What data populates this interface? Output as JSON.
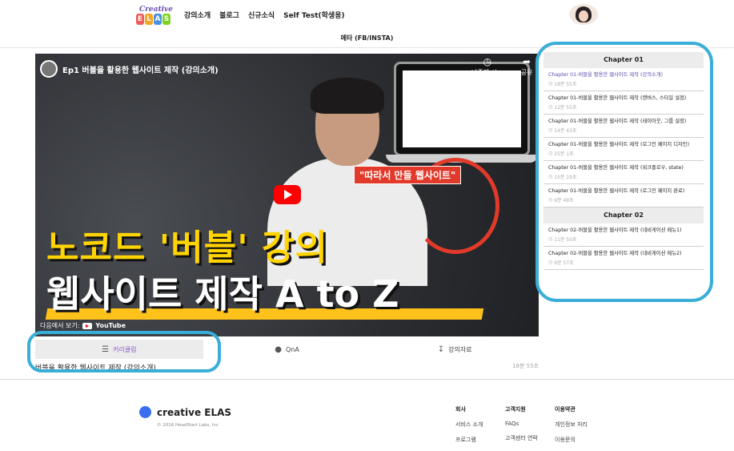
{
  "header": {
    "logo_top": "Creative",
    "logo_letters": [
      "E",
      "L",
      "A",
      "S"
    ],
    "logo_colors": [
      "#f05a5a",
      "#f5a623",
      "#4a90e2",
      "#7ed321"
    ],
    "nav": [
      "강의소개",
      "블로그",
      "신규소식",
      "Self Test(학생용)"
    ],
    "subnav": "메타 (FB/INSTA)"
  },
  "video": {
    "title": "Ep1 버블을 활용한 웹사이트 제작 (강의소개)",
    "watch_later": "나중에 시...",
    "share": "공유",
    "ribbon": "\"따라서 만들 웹사이트\"",
    "headline1": "노코드 '버블' 강의",
    "headline2": "웹사이트 제작 A to Z",
    "watch_on": "다음에서 보기:",
    "youtube": "YouTube"
  },
  "tabs": [
    {
      "label": "커리큘럼",
      "icon": "layers-icon"
    },
    {
      "label": "QnA",
      "icon": "chat-icon"
    },
    {
      "label": "강의자료",
      "icon": "download-icon"
    }
  ],
  "current_lecture": {
    "title": "버블을 활용한 웹사이트 제작 (강의소개)",
    "duration": "18분 55초"
  },
  "curriculum": {
    "chapters": [
      {
        "name": "Chapter 01",
        "lessons": [
          {
            "title": "Chapter 01-버블을 활용한 웹사이트 제작 (강의소개)",
            "duration": "18분 55초"
          },
          {
            "title": "Chapter 01-버블을 활용한 웹사이트 제작 (캔버스, 스타일 설정)",
            "duration": "12분 55초"
          },
          {
            "title": "Chapter 01-버블을 활용한 웹사이트 제작 (레이아웃, 그룹 설정)",
            "duration": "14분 43초"
          },
          {
            "title": "Chapter 01-버블을 활용한 웹사이트 제작 (로그인 페이지 디자인)",
            "duration": "25분 1초"
          },
          {
            "title": "Chapter 01-버블을 활용한 웹사이트 제작 (워크플로우, state)",
            "duration": "15분 19초"
          },
          {
            "title": "Chapter 01-버블을 활용한 웹사이트 제작 (로그인 페이지 완료)",
            "duration": "9분 49초"
          }
        ]
      },
      {
        "name": "Chapter 02",
        "lessons": [
          {
            "title": "Chapter 02-버블을 활용한 웹사이트 제작 (네비게이션 메뉴1)",
            "duration": "11분 50초"
          },
          {
            "title": "Chapter 02-버블을 활용한 웹사이트 제작 (네비게이션 메뉴2)",
            "duration": "9분 57초"
          }
        ]
      }
    ]
  },
  "footer": {
    "brand": "creative ELAS",
    "copyright": "© 2016 HeadStart Labs, Inc",
    "columns": [
      {
        "heading": "회사",
        "items": [
          "서비스 소개",
          "프로그램"
        ]
      },
      {
        "heading": "고객지원",
        "items": [
          "FAQs",
          "고객센터 연락"
        ]
      },
      {
        "heading": "이용약관",
        "items": [
          "개인정보 처리",
          "이용문의"
        ]
      }
    ]
  },
  "colors": {
    "annotation": "#3aaed8",
    "active_tab_text": "#8a5fc8",
    "brand_dot": "#3a6df0"
  }
}
